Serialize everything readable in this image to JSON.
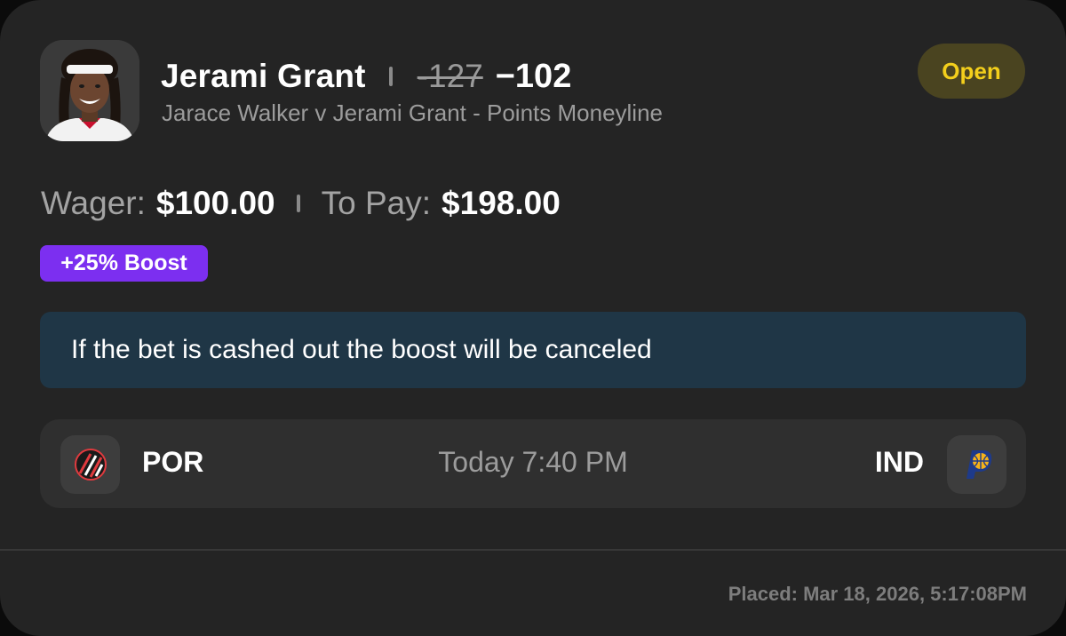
{
  "bet": {
    "player_name": "Jerami Grant",
    "original_odds": "-127",
    "boosted_odds": "−102",
    "market": "Jarace Walker v Jerami Grant - Points Moneyline",
    "status": "Open"
  },
  "wager": {
    "wager_label": "Wager:",
    "wager_value": "$100.00",
    "to_pay_label": "To Pay:",
    "to_pay_value": "$198.00"
  },
  "boost": {
    "label": "+25% Boost",
    "color": "#7c2ff0"
  },
  "notice": {
    "text": "If the bet is cashed out the boost will be canceled"
  },
  "game": {
    "away_team": "POR",
    "away_logo_icon": "trail-blazers-logo-icon",
    "time": "Today 7:40 PM",
    "home_team": "IND",
    "home_logo_icon": "pacers-logo-icon"
  },
  "footer": {
    "placed": "Placed: Mar 18, 2026, 5:17:08PM"
  },
  "colors": {
    "card_bg": "#242424",
    "status_text": "#f3cf1c",
    "status_bg": "#4a4420",
    "notice_bg": "#1f3646"
  }
}
